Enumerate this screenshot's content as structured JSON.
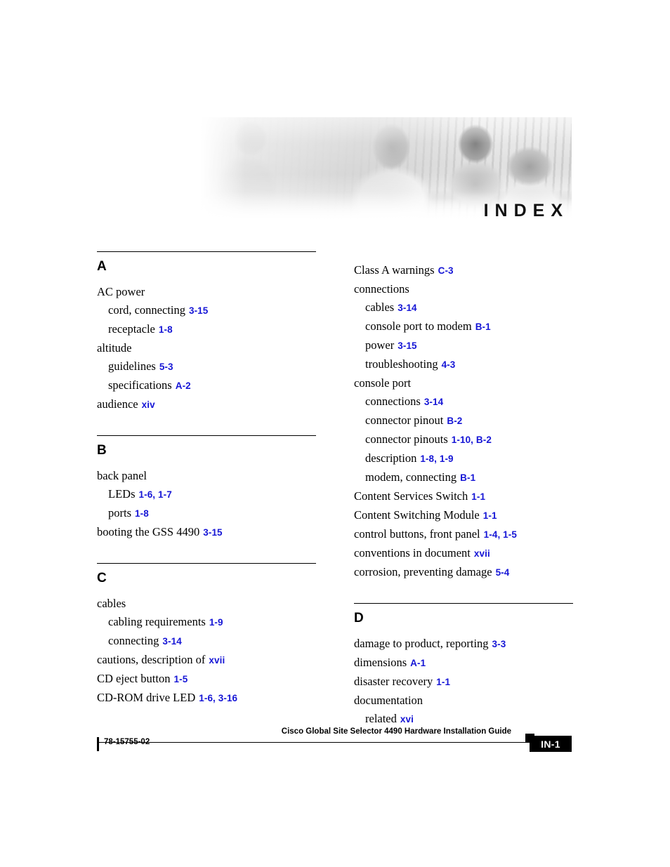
{
  "banner": {
    "title": "INDEX",
    "photo_description": "office-people-banner"
  },
  "columns": [
    {
      "id": "left",
      "blocks": [
        {
          "letter": "A",
          "entries": [
            {
              "level": 1,
              "text": "AC power",
              "refs": ""
            },
            {
              "level": 2,
              "text": "cord, connecting",
              "refs": "3-15"
            },
            {
              "level": 2,
              "text": "receptacle",
              "refs": "1-8"
            },
            {
              "level": 1,
              "text": "altitude",
              "refs": ""
            },
            {
              "level": 2,
              "text": "guidelines",
              "refs": "5-3"
            },
            {
              "level": 2,
              "text": "specifications",
              "refs": "A-2"
            },
            {
              "level": 1,
              "text": "audience",
              "refs": "xiv"
            }
          ]
        },
        {
          "letter": "B",
          "entries": [
            {
              "level": 1,
              "text": "back panel",
              "refs": ""
            },
            {
              "level": 2,
              "text": "LEDs",
              "refs": "1-6, 1-7"
            },
            {
              "level": 2,
              "text": "ports",
              "refs": "1-8"
            },
            {
              "level": 1,
              "text": "booting the GSS 4490",
              "refs": "3-15"
            }
          ]
        },
        {
          "letter": "C",
          "entries": [
            {
              "level": 1,
              "text": "cables",
              "refs": ""
            },
            {
              "level": 2,
              "text": "cabling requirements",
              "refs": "1-9"
            },
            {
              "level": 2,
              "text": "connecting",
              "refs": "3-14"
            },
            {
              "level": 1,
              "text": "cautions, description of",
              "refs": "xvii"
            },
            {
              "level": 1,
              "text": "CD eject button",
              "refs": "1-5"
            },
            {
              "level": 1,
              "text": "CD-ROM drive LED",
              "refs": "1-6, 3-16"
            }
          ]
        }
      ]
    },
    {
      "id": "right",
      "blocks": [
        {
          "letter": "",
          "entries": [
            {
              "level": 1,
              "text": "Class A warnings",
              "refs": "C-3"
            },
            {
              "level": 1,
              "text": "connections",
              "refs": ""
            },
            {
              "level": 2,
              "text": "cables",
              "refs": "3-14"
            },
            {
              "level": 2,
              "text": "console port to modem",
              "refs": "B-1"
            },
            {
              "level": 2,
              "text": "power",
              "refs": "3-15"
            },
            {
              "level": 2,
              "text": "troubleshooting",
              "refs": "4-3"
            },
            {
              "level": 1,
              "text": "console port",
              "refs": ""
            },
            {
              "level": 2,
              "text": "connections",
              "refs": "3-14"
            },
            {
              "level": 2,
              "text": "connector pinout",
              "refs": "B-2"
            },
            {
              "level": 2,
              "text": "connector pinouts",
              "refs": "1-10, B-2"
            },
            {
              "level": 2,
              "text": "description",
              "refs": "1-8, 1-9"
            },
            {
              "level": 2,
              "text": "modem, connecting",
              "refs": "B-1"
            },
            {
              "level": 1,
              "text": "Content Services Switch",
              "refs": "1-1"
            },
            {
              "level": 1,
              "text": "Content Switching Module",
              "refs": "1-1"
            },
            {
              "level": 1,
              "text": "control buttons, front panel",
              "refs": "1-4, 1-5"
            },
            {
              "level": 1,
              "text": "conventions in document",
              "refs": "xvii"
            },
            {
              "level": 1,
              "text": "corrosion, preventing damage",
              "refs": "5-4"
            }
          ]
        },
        {
          "letter": "D",
          "entries": [
            {
              "level": 1,
              "text": "damage to product, reporting",
              "refs": "3-3"
            },
            {
              "level": 1,
              "text": "dimensions",
              "refs": "A-1"
            },
            {
              "level": 1,
              "text": "disaster recovery",
              "refs": "1-1"
            },
            {
              "level": 1,
              "text": "documentation",
              "refs": ""
            },
            {
              "level": 2,
              "text": "related",
              "refs": "xvi"
            }
          ]
        }
      ]
    }
  ],
  "footer": {
    "guide_title": "Cisco Global Site Selector 4490 Hardware Installation Guide",
    "document_number": "78-15755-02",
    "page_number": "IN-1"
  },
  "colors": {
    "reference_link": "#1616d6",
    "text": "#000000",
    "page_badge_background": "#000000"
  }
}
